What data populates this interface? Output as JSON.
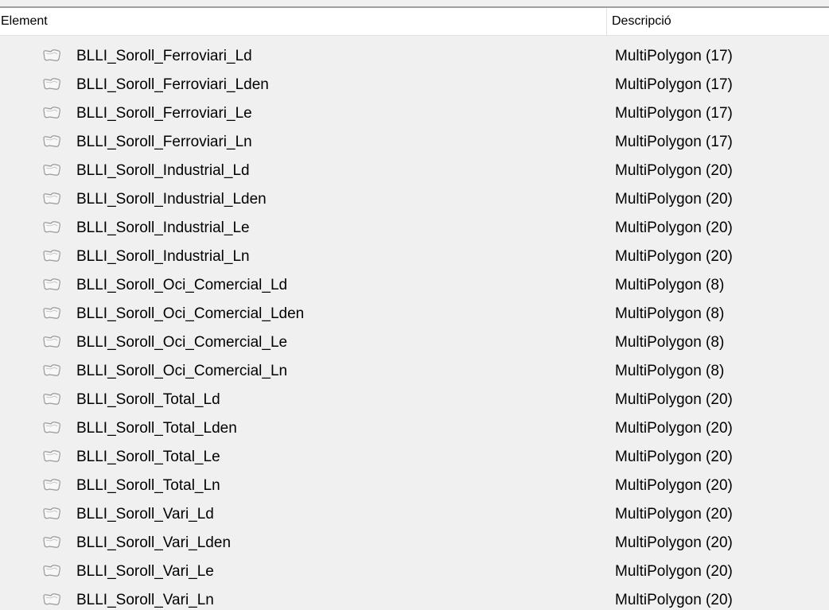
{
  "columns": {
    "element": "Element",
    "description": "Descripció"
  },
  "rows": [
    {
      "name": "BLLI_Soroll_Ferroviari_Ld",
      "desc": "MultiPolygon (17)",
      "icon": "polygon-layer-icon"
    },
    {
      "name": "BLLI_Soroll_Ferroviari_Lden",
      "desc": "MultiPolygon (17)",
      "icon": "polygon-layer-icon"
    },
    {
      "name": "BLLI_Soroll_Ferroviari_Le",
      "desc": "MultiPolygon (17)",
      "icon": "polygon-layer-icon"
    },
    {
      "name": "BLLI_Soroll_Ferroviari_Ln",
      "desc": "MultiPolygon (17)",
      "icon": "polygon-layer-icon"
    },
    {
      "name": "BLLI_Soroll_Industrial_Ld",
      "desc": "MultiPolygon (20)",
      "icon": "polygon-layer-icon"
    },
    {
      "name": "BLLI_Soroll_Industrial_Lden",
      "desc": "MultiPolygon (20)",
      "icon": "polygon-layer-icon"
    },
    {
      "name": "BLLI_Soroll_Industrial_Le",
      "desc": "MultiPolygon (20)",
      "icon": "polygon-layer-icon"
    },
    {
      "name": "BLLI_Soroll_Industrial_Ln",
      "desc": "MultiPolygon (20)",
      "icon": "polygon-layer-icon"
    },
    {
      "name": "BLLI_Soroll_Oci_Comercial_Ld",
      "desc": "MultiPolygon (8)",
      "icon": "polygon-layer-icon"
    },
    {
      "name": "BLLI_Soroll_Oci_Comercial_Lden",
      "desc": "MultiPolygon (8)",
      "icon": "polygon-layer-icon"
    },
    {
      "name": "BLLI_Soroll_Oci_Comercial_Le",
      "desc": "MultiPolygon (8)",
      "icon": "polygon-layer-icon"
    },
    {
      "name": "BLLI_Soroll_Oci_Comercial_Ln",
      "desc": "MultiPolygon (8)",
      "icon": "polygon-layer-icon"
    },
    {
      "name": "BLLI_Soroll_Total_Ld",
      "desc": "MultiPolygon (20)",
      "icon": "polygon-layer-icon"
    },
    {
      "name": "BLLI_Soroll_Total_Lden",
      "desc": "MultiPolygon (20)",
      "icon": "polygon-layer-icon"
    },
    {
      "name": "BLLI_Soroll_Total_Le",
      "desc": "MultiPolygon (20)",
      "icon": "polygon-layer-icon"
    },
    {
      "name": "BLLI_Soroll_Total_Ln",
      "desc": "MultiPolygon (20)",
      "icon": "polygon-layer-icon"
    },
    {
      "name": "BLLI_Soroll_Vari_Ld",
      "desc": "MultiPolygon (20)",
      "icon": "polygon-layer-icon"
    },
    {
      "name": "BLLI_Soroll_Vari_Lden",
      "desc": "MultiPolygon (20)",
      "icon": "polygon-layer-icon"
    },
    {
      "name": "BLLI_Soroll_Vari_Le",
      "desc": "MultiPolygon (20)",
      "icon": "polygon-layer-icon"
    },
    {
      "name": "BLLI_Soroll_Vari_Ln",
      "desc": "MultiPolygon (20)",
      "icon": "polygon-layer-icon"
    }
  ],
  "colors": {
    "background": "#f0f0f0",
    "header": "#ffffff",
    "icon_stroke": "#9a9a9a",
    "icon_fill": "#f7f7f7"
  }
}
